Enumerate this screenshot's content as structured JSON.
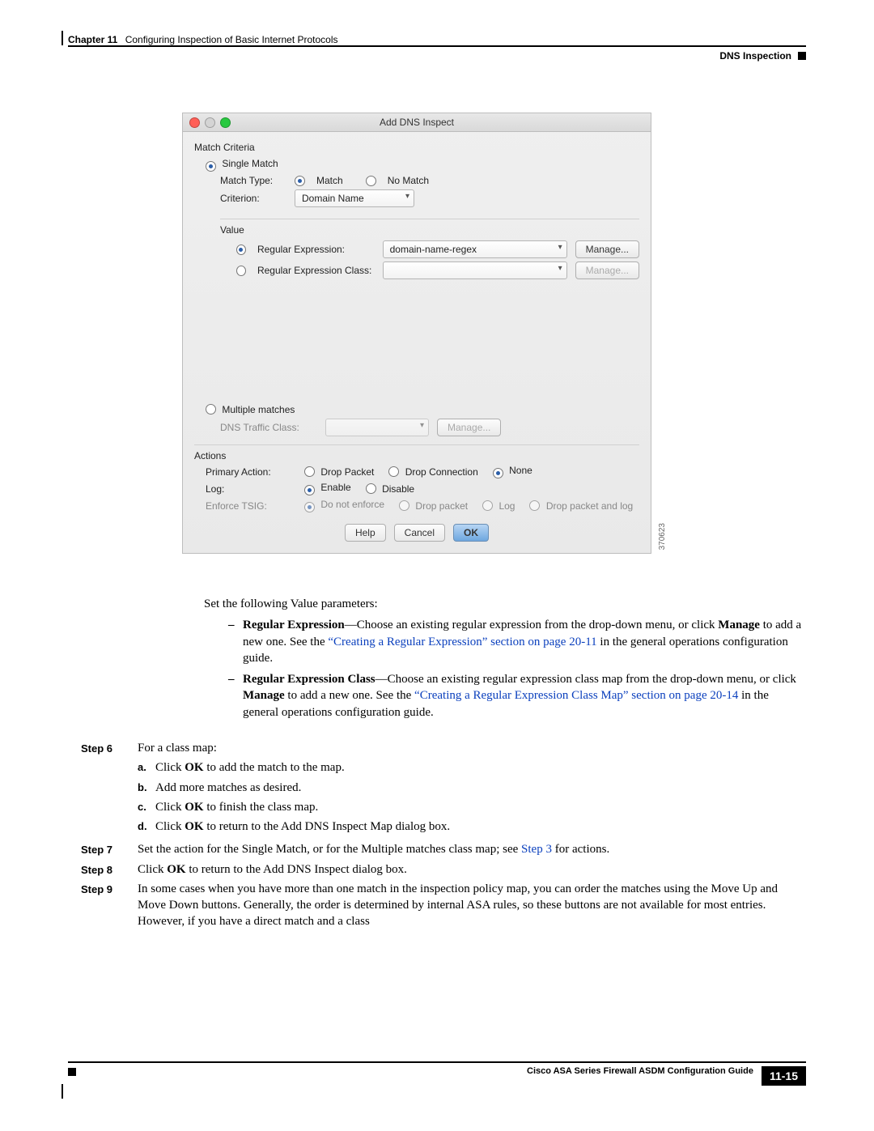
{
  "header": {
    "chapter_label": "Chapter 11",
    "chapter_title": "Configuring Inspection of Basic Internet Protocols",
    "section": "DNS Inspection"
  },
  "dialog": {
    "title": "Add DNS Inspect",
    "match_criteria_label": "Match Criteria",
    "single_match": "Single Match",
    "match_type_label": "Match Type:",
    "match_opt": "Match",
    "no_match_opt": "No Match",
    "criterion_label": "Criterion:",
    "criterion_value": "Domain Name",
    "value_label": "Value",
    "regex_label": "Regular Expression:",
    "regex_value": "domain-name-regex",
    "regex_class_label": "Regular Expression Class:",
    "manage_btn": "Manage...",
    "multiple_matches": "Multiple matches",
    "dns_traffic_class_label": "DNS Traffic Class:",
    "actions_label": "Actions",
    "primary_action_label": "Primary Action:",
    "drop_packet": "Drop Packet",
    "drop_connection": "Drop Connection",
    "none": "None",
    "log_label": "Log:",
    "enable": "Enable",
    "disable": "Disable",
    "enforce_tsig_label": "Enforce TSIG:",
    "do_not_enforce": "Do not enforce",
    "drop_packet2": "Drop packet",
    "log_opt": "Log",
    "drop_and_log": "Drop packet and log",
    "help": "Help",
    "cancel": "Cancel",
    "ok": "OK",
    "figno": "370623"
  },
  "text": {
    "set_value": "Set the following Value parameters:",
    "regex_bold": "Regular Expression",
    "regex_rest": "—Choose an existing regular expression from the drop-down menu, or click ",
    "manage_bold": "Manage",
    "regex_after_manage": " to add a new one. See the ",
    "regex_link": "“Creating a Regular Expression” section on page 20-11",
    "regex_tail": " in the general operations configuration guide.",
    "regex_class_bold": "Regular Expression Class",
    "regex_class_rest": "—Choose an existing regular expression class map from the drop-down menu, or click ",
    "regex_class_after_manage": " to add a new one. See the ",
    "regex_class_link": "“Creating a Regular Expression Class Map” section on page 20-14",
    "regex_class_tail": " in the general operations configuration guide."
  },
  "steps": {
    "s6_label": "Step 6",
    "s6_intro": "For a class map:",
    "s6_a": "Click ",
    "s6_a_bold": "OK",
    "s6_a_tail": " to add the match to the map.",
    "s6_b": "Add more matches as desired.",
    "s6_c": "Click ",
    "s6_c_bold": "OK",
    "s6_c_tail": " to finish the class map.",
    "s6_d": "Click ",
    "s6_d_bold": "OK",
    "s6_d_tail": " to return to the Add DNS Inspect Map dialog box.",
    "s7_label": "Step 7",
    "s7_text": "Set the action for the Single Match, or for the Multiple matches class map; see ",
    "s7_link": "Step 3",
    "s7_tail": " for actions.",
    "s8_label": "Step 8",
    "s8_text": "Click ",
    "s8_bold": "OK",
    "s8_tail": " to return to the Add DNS Inspect dialog box.",
    "s9_label": "Step 9",
    "s9_text": "In some cases when you have more than one match in the inspection policy map, you can order the matches using the Move Up and Move Down buttons. Generally, the order is determined by internal ASA rules, so these buttons are not available for most entries. However, if you have a direct match and a class"
  },
  "footer": {
    "guide": "Cisco ASA Series Firewall ASDM Configuration Guide",
    "page": "11-15"
  }
}
